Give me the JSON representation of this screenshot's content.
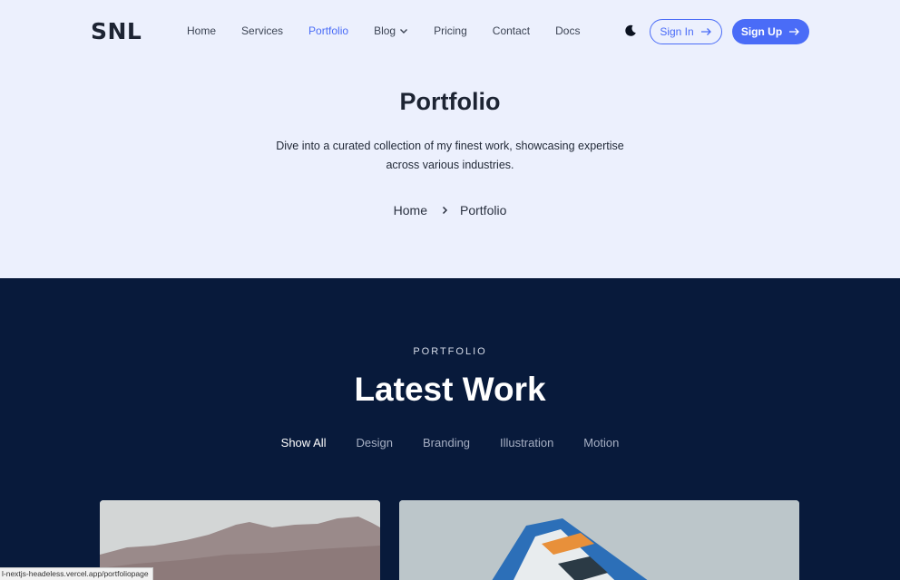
{
  "header": {
    "logo": "SNL",
    "nav": [
      {
        "label": "Home"
      },
      {
        "label": "Services"
      },
      {
        "label": "Portfolio",
        "active": true
      },
      {
        "label": "Blog",
        "has_dropdown": true
      },
      {
        "label": "Pricing"
      },
      {
        "label": "Contact"
      },
      {
        "label": "Docs"
      }
    ],
    "theme_icon": "moon-icon",
    "signin_label": "Sign In",
    "signup_label": "Sign Up"
  },
  "hero": {
    "title": "Portfolio",
    "description": "Dive into a curated collection of my finest work, showcasing expertise across various industries.",
    "breadcrumb": [
      "Home",
      "Portfolio"
    ]
  },
  "portfolio": {
    "eyebrow": "PORTFOLIO",
    "title": "Latest Work",
    "filters": [
      "Show All",
      "Design",
      "Branding",
      "Illustration",
      "Motion"
    ],
    "active_filter": "Show All"
  },
  "status_bar": {
    "url": "l-nextjs-headeless.vercel.app/portfoliopage"
  },
  "colors": {
    "accent": "#4a6cf7",
    "hero_bg": "#ecf0fd",
    "dark_bg": "#081a3b"
  }
}
